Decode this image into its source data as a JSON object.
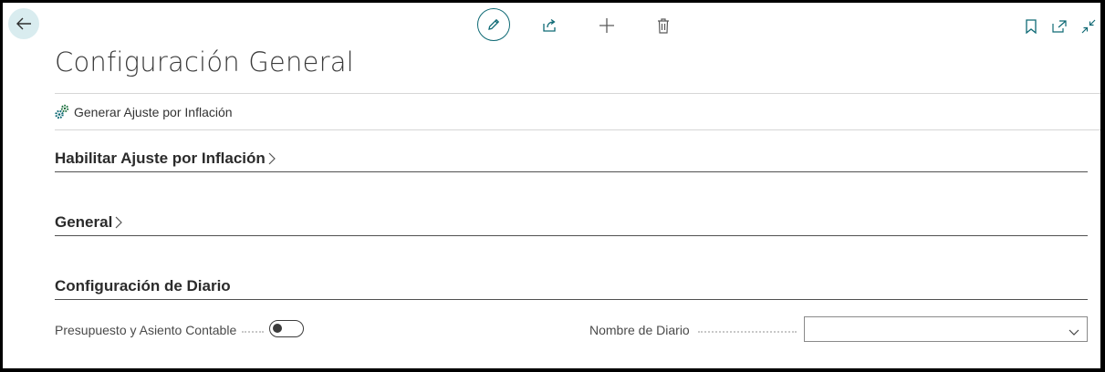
{
  "page": {
    "title": "Configuración General"
  },
  "toolbar": {
    "back_icon": "arrow-left-icon",
    "edit_icon": "pencil-icon",
    "share_icon": "share-icon",
    "new_icon": "plus-icon",
    "delete_icon": "trash-icon",
    "bookmark_icon": "bookmark-icon",
    "open_new_window_icon": "open-in-new-window-icon",
    "collapse_icon": "collapse-icon"
  },
  "actions": {
    "generate_label": "Generar Ajuste por Inflación"
  },
  "sections": {
    "enable": "Habilitar Ajuste por Inflación",
    "general": "General",
    "journal": "Configuración de Diario"
  },
  "fields": {
    "budget_label": "Presupuesto y Asiento Contable",
    "budget_value": false,
    "journal_name_label": "Nombre de Diario",
    "journal_name_value": ""
  },
  "colors": {
    "accent": "#0f6a75",
    "back_bg": "#d9ecef"
  }
}
